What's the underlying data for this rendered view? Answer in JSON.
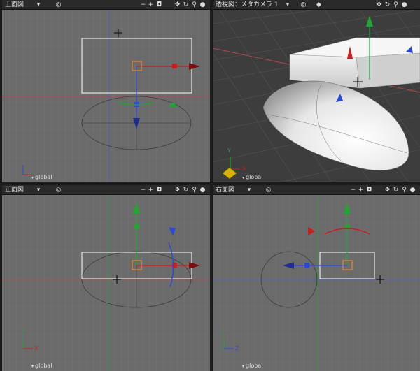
{
  "viewports": {
    "top": {
      "title": "上面図",
      "coord_label": "global"
    },
    "persp": {
      "title": "透視図：メタカメラ 1",
      "coord_label": "global"
    },
    "front": {
      "title": "正面図",
      "coord_label": "global"
    },
    "right": {
      "title": "右面図",
      "coord_label": "global"
    }
  },
  "header_icons": {
    "dropdown": "▾",
    "view_mode": "◎",
    "zoom_out": "−",
    "zoom_in": "+",
    "camera": "◘",
    "pan": "✥",
    "rotate": "↻",
    "zoom": "⚲",
    "render_ball": "●"
  },
  "axis_labels": {
    "x": "X",
    "y": "Y",
    "z": "Z"
  },
  "colors": {
    "x_axis": "#c81e1e",
    "y_axis": "#1fa82f",
    "z_axis": "#2a49d8",
    "bbox": "#ffffff",
    "pivot": "#e88a2e"
  }
}
